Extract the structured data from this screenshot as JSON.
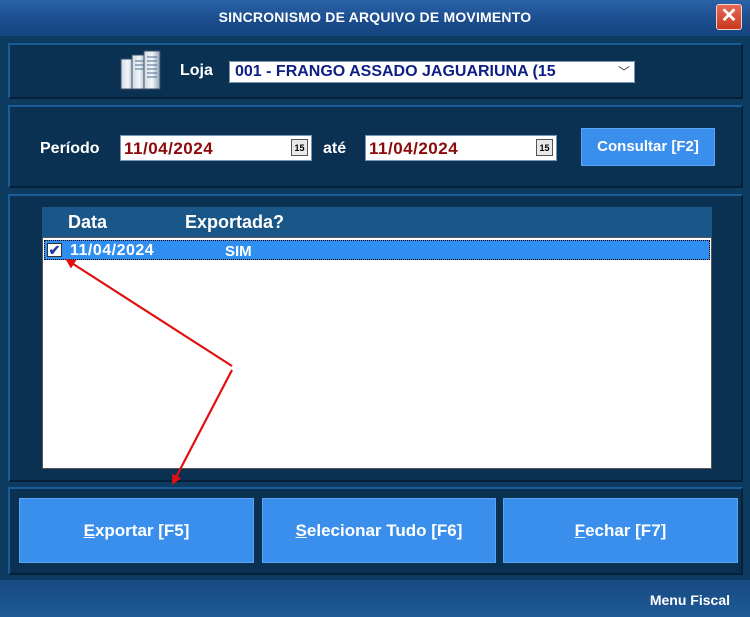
{
  "window": {
    "title": "SINCRONISMO DE ARQUIVO DE MOVIMENTO",
    "close_glyph": "✕"
  },
  "store": {
    "label": "Loja",
    "selected": "001 - FRANGO ASSADO JAGUARIUNA (15",
    "icon": "server-icon"
  },
  "period": {
    "label": "Período",
    "from": "11/04/2024",
    "to_label": "até",
    "to": "11/04/2024",
    "calendar_glyph": "15",
    "consult_label": "Consultar [F2]"
  },
  "grid": {
    "columns": [
      "Data",
      "Exportada?"
    ],
    "rows": [
      {
        "checked": true,
        "date": "11/04/2024",
        "exported": "SIM"
      }
    ]
  },
  "buttons": {
    "export": {
      "key": "E",
      "rest": "xportar [F5]"
    },
    "select_all": {
      "key": "S",
      "rest": "elecionar Tudo [F6]"
    },
    "close": {
      "key": "F",
      "rest": "echar [F7]"
    }
  },
  "status": {
    "text": "Menu Fiscal"
  },
  "colors": {
    "background": "#0d3a5f",
    "button": "#3a8fed",
    "selection": "#2f8ef0",
    "date_text": "#8b0a0a",
    "arrow": "#e01010"
  }
}
